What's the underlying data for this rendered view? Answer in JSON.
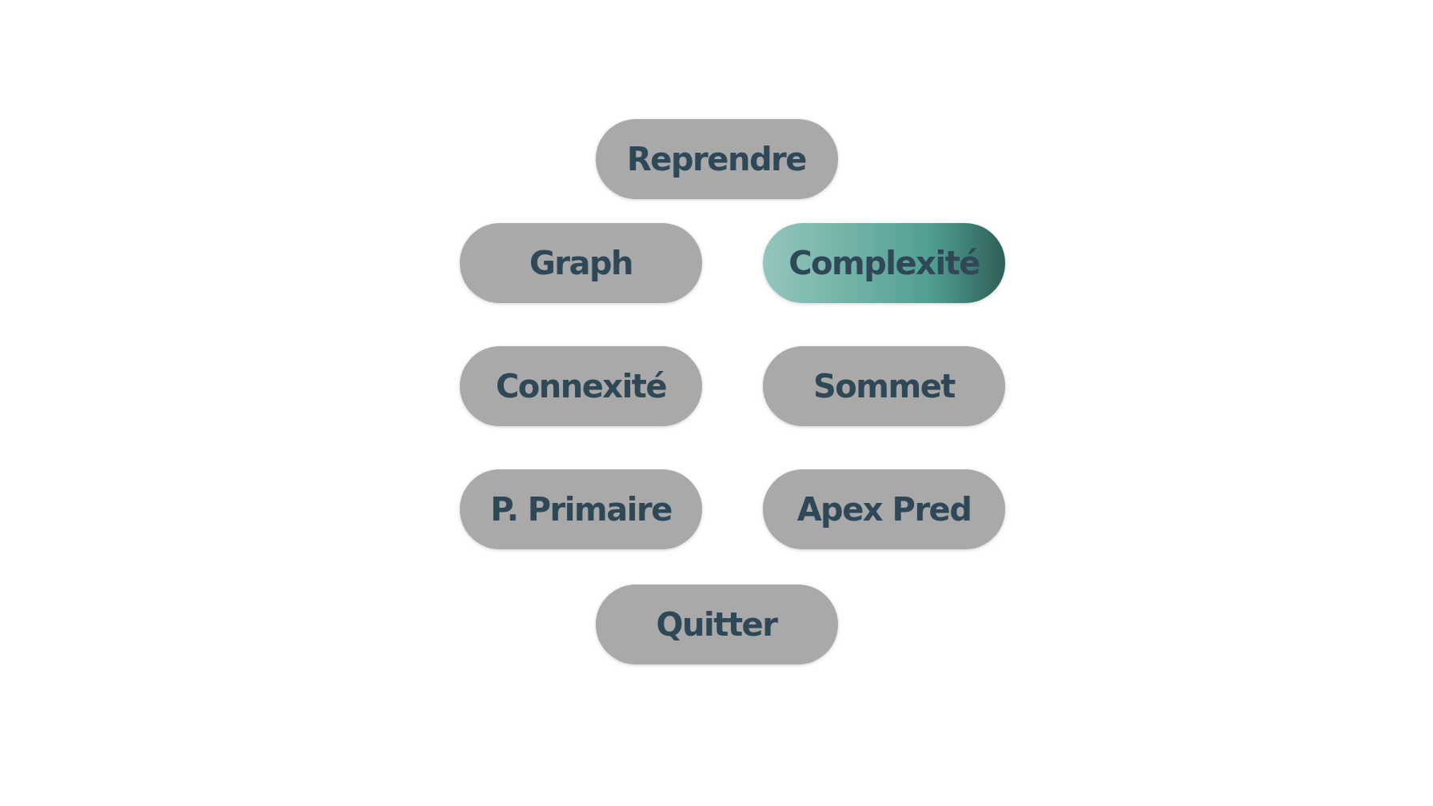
{
  "menu": {
    "buttons": [
      {
        "label": "Reprendre",
        "selected": false
      },
      {
        "label": "Graph",
        "selected": false
      },
      {
        "label": "Complexité",
        "selected": true
      },
      {
        "label": "Connexité",
        "selected": false
      },
      {
        "label": "Sommet",
        "selected": false
      },
      {
        "label": "P. Primaire",
        "selected": false
      },
      {
        "label": "Apex Pred",
        "selected": false
      },
      {
        "label": "Quitter",
        "selected": false
      }
    ]
  }
}
